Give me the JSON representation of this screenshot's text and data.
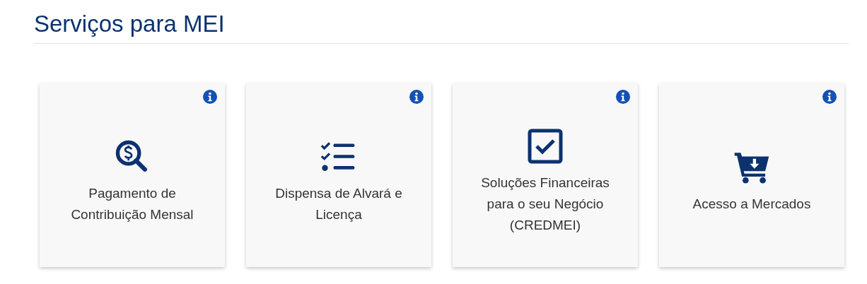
{
  "heading": "Serviços para MEI",
  "cards": [
    {
      "label": "Pagamento de Contribuição Mensal"
    },
    {
      "label": "Dispensa de Alvará e Licença"
    },
    {
      "label": "Soluções Financeiras para o seu Negócio (CREDMEI)"
    },
    {
      "label": "Acesso a Mercados"
    }
  ]
}
